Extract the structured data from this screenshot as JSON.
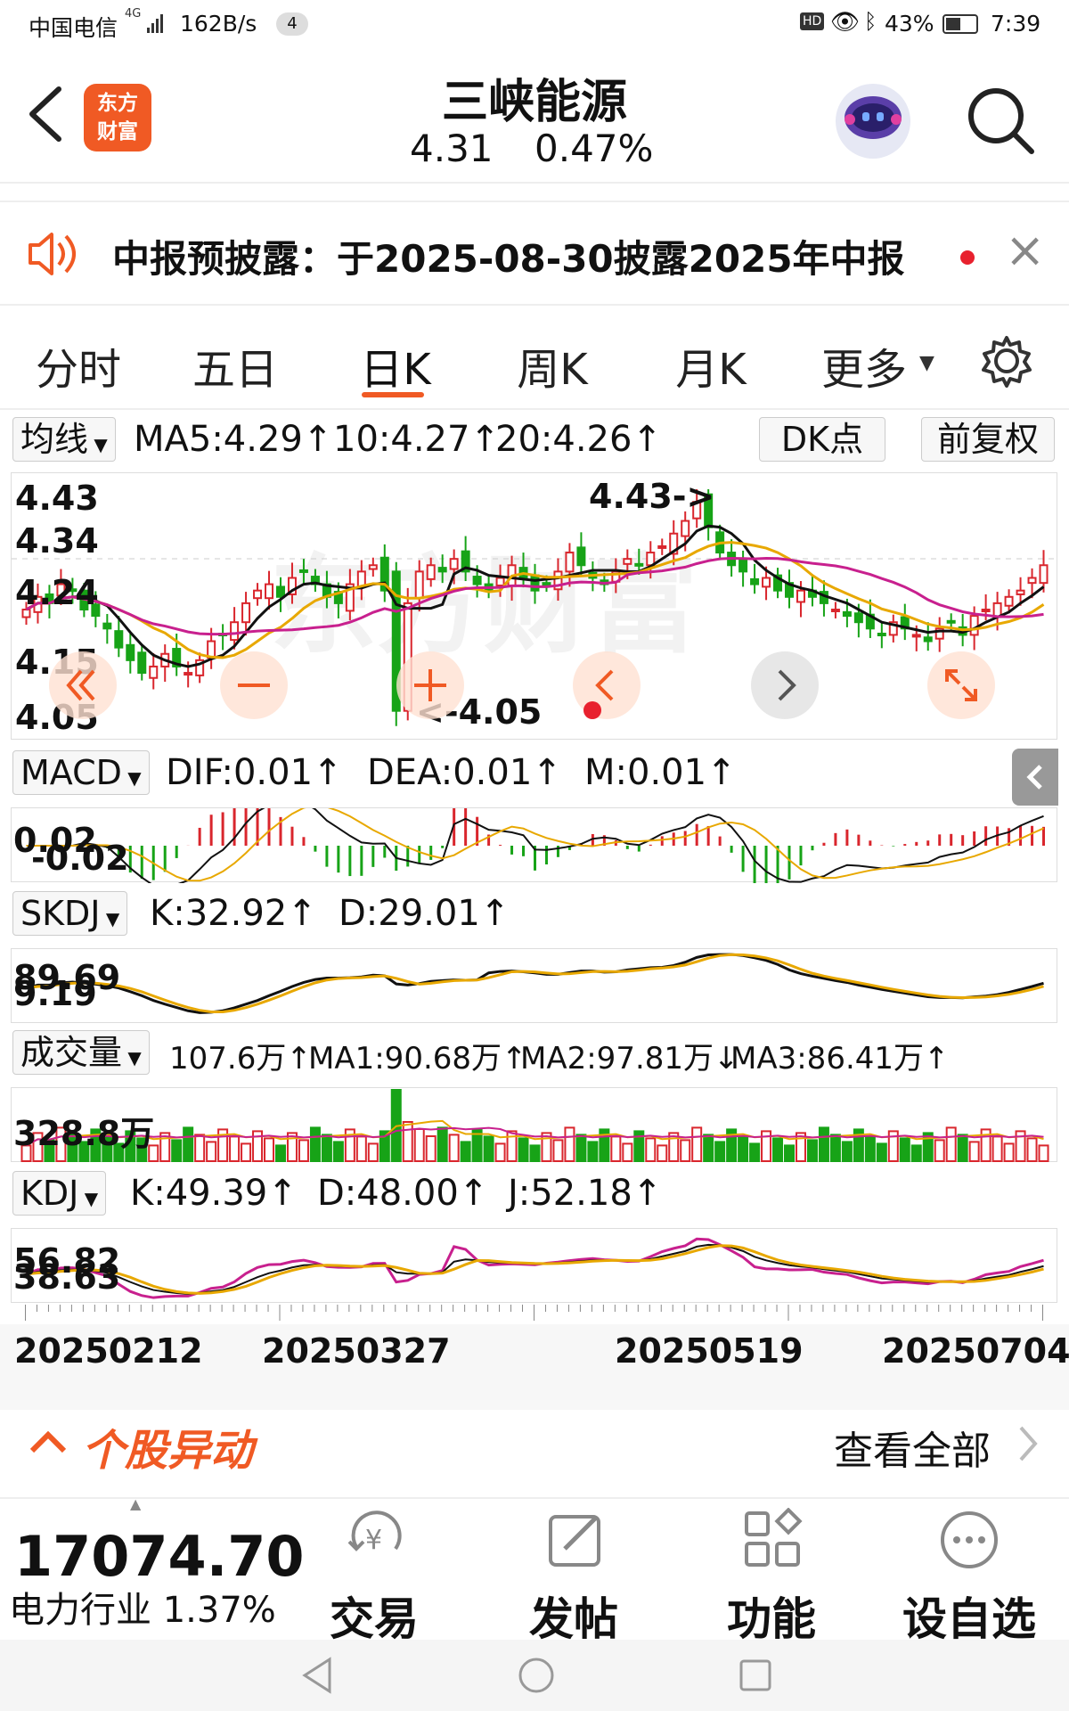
{
  "status_bar": {
    "carrier": "中国电信",
    "network": "4G",
    "speed": "162B/s",
    "notif_count": "4",
    "hd": "HD",
    "battery": "43%",
    "time": "7:39"
  },
  "header": {
    "back_icon": "back-arrow-icon",
    "logo_text": "东方财富",
    "stock_name": "三峡能源",
    "price": "4.31",
    "change": "0.47%"
  },
  "notice": {
    "text": "中报预披露：于2025-08-30披露2025年中报",
    "close": "×"
  },
  "tabs": [
    {
      "label": "分时"
    },
    {
      "label": "五日"
    },
    {
      "label": "日K",
      "active": true
    },
    {
      "label": "周K"
    },
    {
      "label": "月K"
    },
    {
      "label": "更多"
    }
  ],
  "ma_row": {
    "dropdown": "均线",
    "ma5": "MA5:4.29↑",
    "ma10": "10:4.27↑",
    "ma20": "20:4.26↑",
    "dk": "DK点",
    "fq": "前复权"
  },
  "kline": {
    "y_labels": [
      "4.43",
      "4.34",
      "4.24",
      "4.15",
      "4.05"
    ],
    "high_label": "4.43->",
    "low_label": "<-4.05"
  },
  "macd": {
    "dropdown": "MACD",
    "dif": "DIF:0.01↑",
    "dea": "DEA:0.01↑",
    "m": "M:0.01↑",
    "y_top": "0.02",
    "y_bottom": "-0.02"
  },
  "skdj": {
    "dropdown": "SKDJ",
    "k": "K:32.92↑",
    "d": "D:29.01↑",
    "y_top": "89.69",
    "y_bottom": "9.19"
  },
  "volume": {
    "dropdown": "成交量",
    "vol": "107.6万↑",
    "ma1": "MA1:90.68万↑",
    "ma2": "MA2:97.81万↓",
    "ma3": "MA3:86.41万↑",
    "y_top": "328.8万"
  },
  "kdj": {
    "dropdown": "KDJ",
    "k": "K:49.39↑",
    "d": "D:48.00↑",
    "j": "J:52.18↑",
    "y_top": "56.82",
    "y_bottom": "38.63"
  },
  "dates": [
    "20250212",
    "20250327",
    "20250519",
    "20250704"
  ],
  "movement": {
    "title": "个股异动",
    "view_all": "查看全部"
  },
  "bottom": {
    "index_value": "17074.70",
    "index_name": "电力行业 1.37%",
    "items": [
      {
        "label": "交易",
        "icon": "yuan-cycle-icon"
      },
      {
        "label": "发帖",
        "icon": "edit-icon"
      },
      {
        "label": "功能",
        "icon": "grid-icon"
      },
      {
        "label": "设自选",
        "icon": "more-dots-icon"
      }
    ]
  },
  "colors": {
    "up": "#d9262d",
    "down": "#17a317",
    "ma5": "#111111",
    "ma10": "#e8a800",
    "ma20": "#c8208e",
    "accent": "#f05a24"
  },
  "chart_data": {
    "type": "candlestick",
    "title": "",
    "y_range": [
      4.05,
      4.43
    ],
    "series": [
      {
        "name": "MA5",
        "values": [
          4.29
        ]
      },
      {
        "name": "10",
        "values": [
          4.27
        ]
      },
      {
        "name": "20",
        "values": [
          4.26
        ]
      }
    ],
    "closes": [
      4.24,
      4.26,
      4.25,
      4.28,
      4.27,
      4.24,
      4.23,
      4.21,
      4.18,
      4.16,
      4.14,
      4.15,
      4.17,
      4.15,
      4.14,
      4.16,
      4.19,
      4.2,
      4.22,
      4.25,
      4.27,
      4.28,
      4.26,
      4.29,
      4.3,
      4.28,
      4.26,
      4.25,
      4.28,
      4.3,
      4.31,
      4.27,
      4.08,
      4.25,
      4.3,
      4.31,
      4.3,
      4.32,
      4.3,
      4.28,
      4.27,
      4.29,
      4.31,
      4.29,
      4.27,
      4.28,
      4.3,
      4.33,
      4.31,
      4.29,
      4.28,
      4.3,
      4.32,
      4.31,
      4.33,
      4.34,
      4.36,
      4.38,
      4.41,
      4.37,
      4.33,
      4.31,
      4.3,
      4.28,
      4.29,
      4.27,
      4.26,
      4.27,
      4.26,
      4.25,
      4.24,
      4.23,
      4.22,
      4.21,
      4.2,
      4.22,
      4.21,
      4.2,
      4.19,
      4.21,
      4.22,
      4.2,
      4.23,
      4.24,
      4.25,
      4.26,
      4.27,
      4.29,
      4.31
    ]
  }
}
